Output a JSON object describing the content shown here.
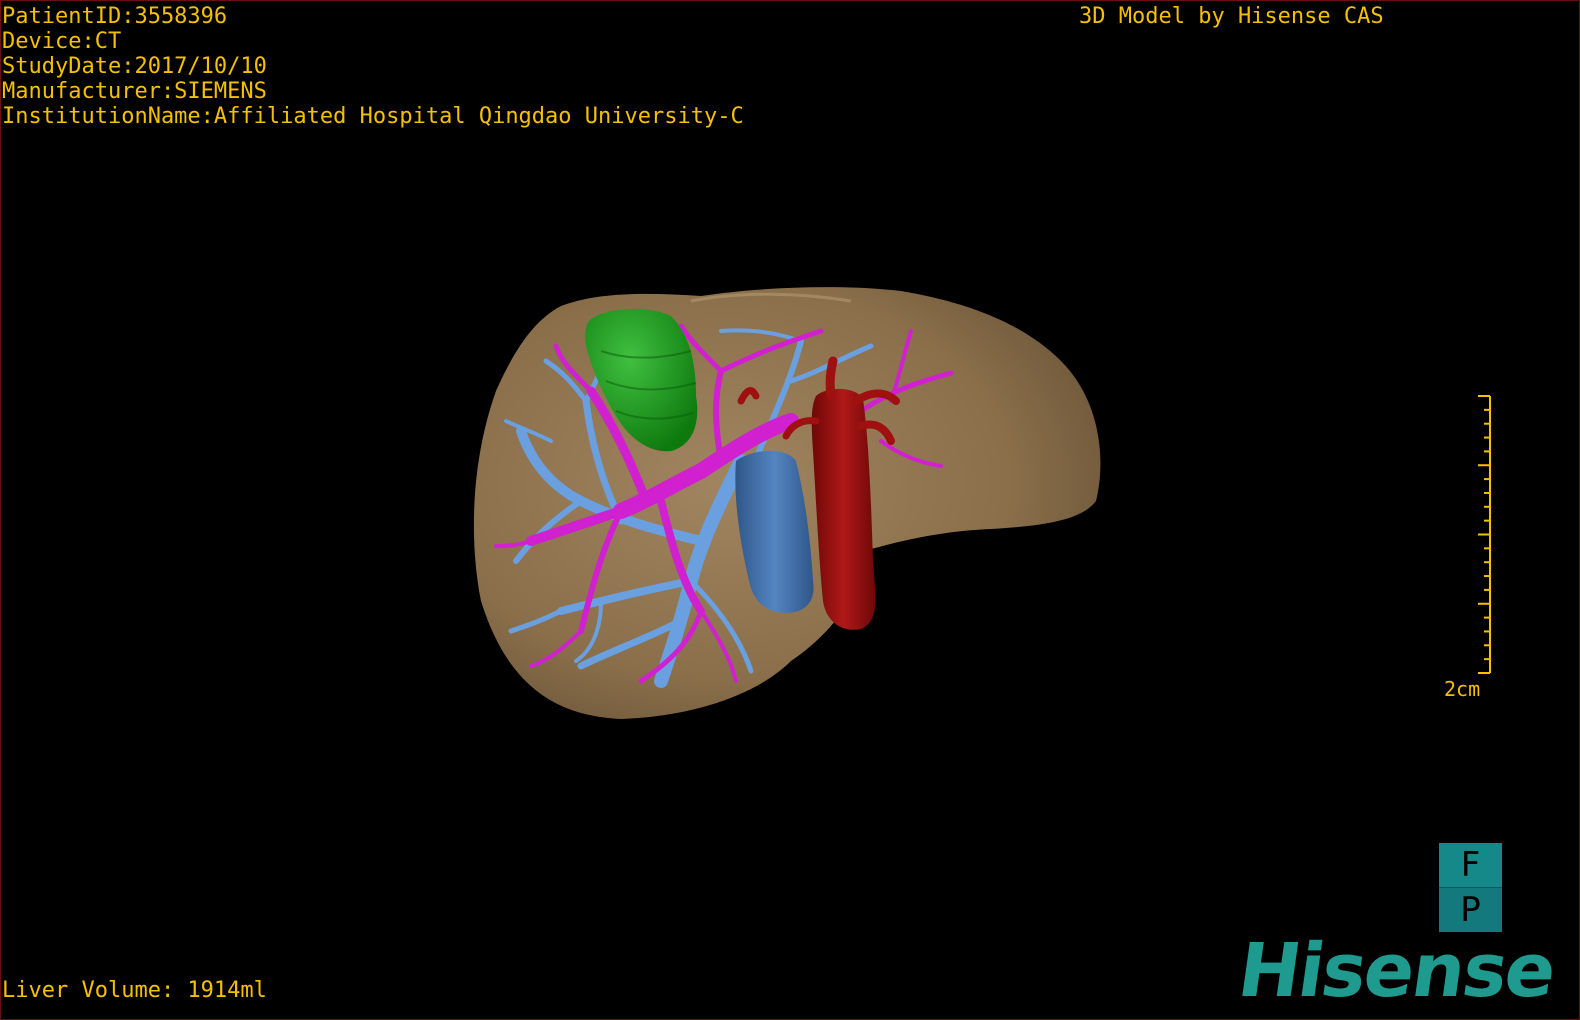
{
  "info": {
    "patient_id": "PatientID:3558396",
    "device": "Device:CT",
    "study_date": "StudyDate:2017/10/10",
    "manufacturer": "Manufacturer:SIEMENS",
    "institution": "InstitutionName:Affiliated Hospital Qingdao University-C"
  },
  "brand_text": "3D Model by Hisense CAS",
  "volume": "Liver Volume: 1914ml",
  "scale_bar": {
    "label": "2cm",
    "ticks": 20
  },
  "orientation": {
    "top": "F",
    "bottom": "P"
  },
  "logo": "Hisense",
  "colors": {
    "text": "#f5c000",
    "liver": "#8a6f4a",
    "lesion": "#1fa01f",
    "portal_vein": "#d020d0",
    "hepatic_vein": "#6a9fe0",
    "ivc": "#4a7ab8",
    "aorta": "#a01010",
    "brand": "#1f9a8f"
  }
}
